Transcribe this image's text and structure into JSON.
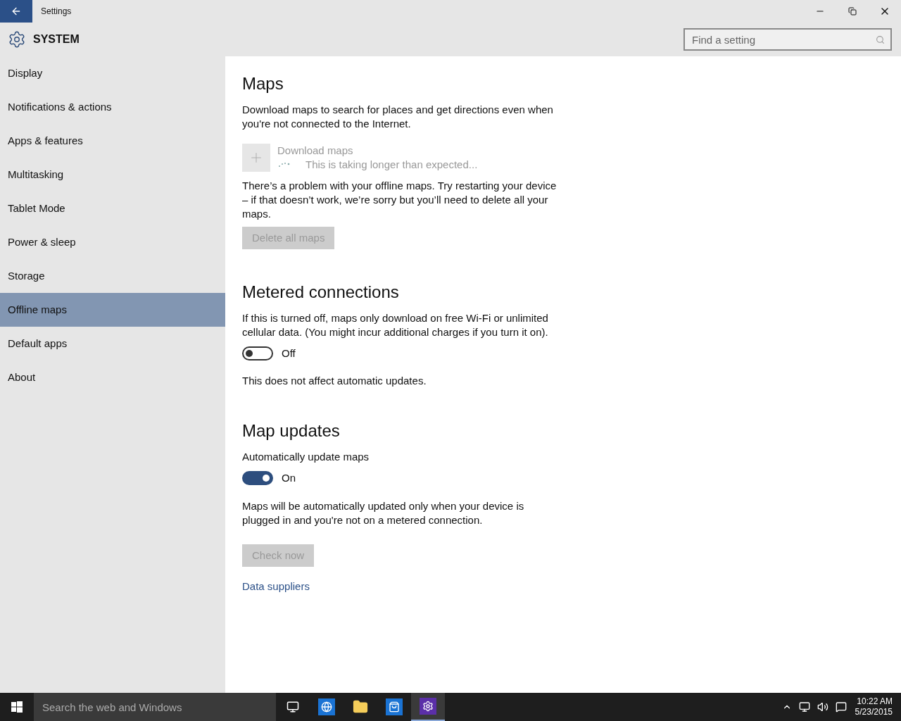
{
  "window": {
    "title": "Settings"
  },
  "header": {
    "title": "SYSTEM",
    "search": {
      "placeholder": "Find a setting"
    }
  },
  "sidebar": {
    "items": [
      {
        "label": "Display",
        "selected": false
      },
      {
        "label": "Notifications & actions",
        "selected": false
      },
      {
        "label": "Apps & features",
        "selected": false
      },
      {
        "label": "Multitasking",
        "selected": false
      },
      {
        "label": "Tablet Mode",
        "selected": false
      },
      {
        "label": "Power & sleep",
        "selected": false
      },
      {
        "label": "Storage",
        "selected": false
      },
      {
        "label": "Offline maps",
        "selected": true
      },
      {
        "label": "Default apps",
        "selected": false
      },
      {
        "label": "About",
        "selected": false
      }
    ]
  },
  "maps": {
    "heading": "Maps",
    "description": "Download maps to search for places and get directions even when you're not connected to the Internet.",
    "download": {
      "label": "Download maps",
      "status": "This is taking longer than expected...",
      "disabled": true
    },
    "problem": "There’s a problem with your offline maps. Try restarting your device – if that doesn’t work, we’re sorry but you’ll need to delete all your maps.",
    "delete_button": {
      "label": "Delete all maps",
      "disabled": true
    }
  },
  "metered": {
    "heading": "Metered connections",
    "description": "If this is turned off, maps only download on free Wi-Fi or unlimited cellular data. (You might incur additional charges if you turn it on).",
    "toggle": {
      "on": false,
      "label": "Off"
    },
    "note": "This does not affect automatic updates."
  },
  "updates": {
    "heading": "Map updates",
    "toggle_label": "Automatically update maps",
    "toggle": {
      "on": true,
      "label": "On"
    },
    "description": "Maps will be automatically updated only when your device is plugged in and you're not on a metered connection.",
    "check_button": {
      "label": "Check now",
      "disabled": true
    },
    "link": "Data suppliers"
  },
  "taskbar": {
    "search": {
      "placeholder": "Search the web and Windows"
    },
    "clock": {
      "time": "10:22 AM",
      "date": "5/23/2015"
    }
  }
}
